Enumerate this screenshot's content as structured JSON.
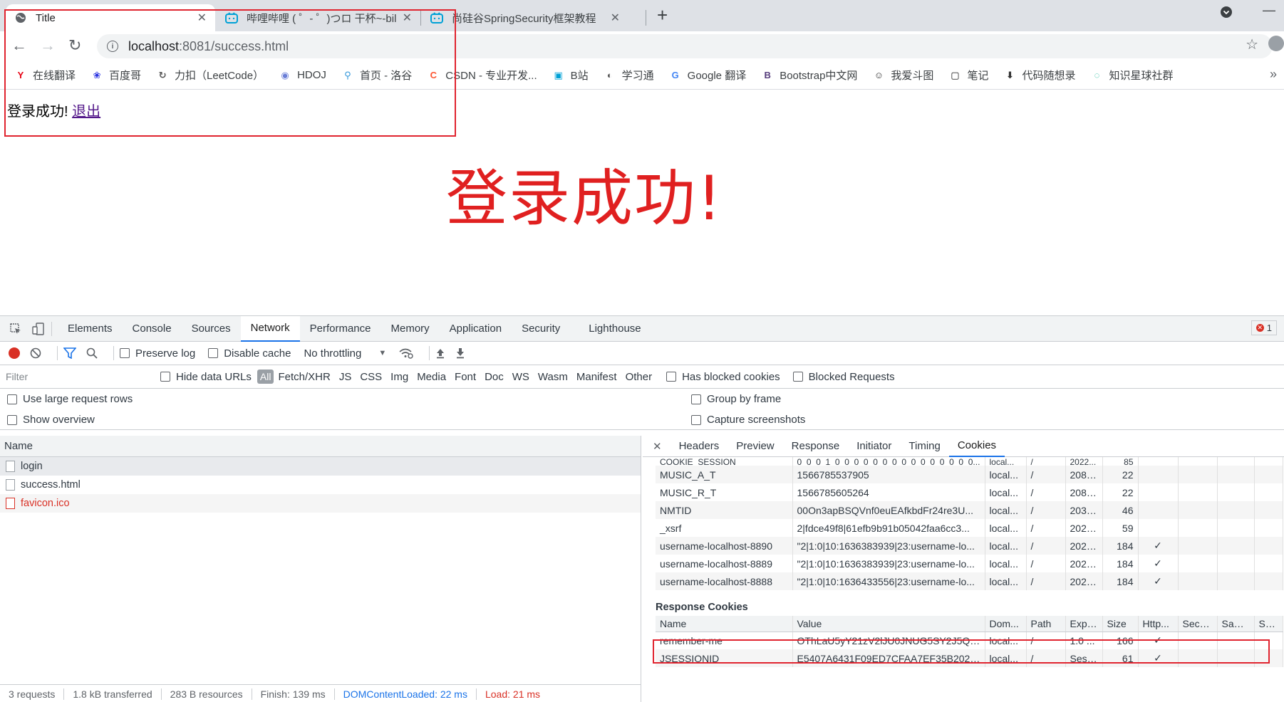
{
  "browser": {
    "tabs": [
      {
        "title": "Title"
      },
      {
        "title": "哔哩哔哩 ( ゜- ゜)つロ 干杯~-bilibili"
      },
      {
        "title": "尚硅谷SpringSecurity框架教程"
      }
    ],
    "url_host": "localhost",
    "url_rest": ":8081/success.html",
    "bookmarks": [
      {
        "label": "在线翻译",
        "icon": "Y",
        "color": "#e60012"
      },
      {
        "label": "百度哥",
        "icon": "❀",
        "color": "#2932e1"
      },
      {
        "label": "力扣（LeetCode）",
        "icon": "↻",
        "color": "#555"
      },
      {
        "label": "HDOJ",
        "icon": "◉",
        "color": "#6b7fd7"
      },
      {
        "label": "首页 - 洛谷",
        "icon": "⚲",
        "color": "#3498db"
      },
      {
        "label": "CSDN - 专业开发...",
        "icon": "C",
        "color": "#fc5531"
      },
      {
        "label": "B站",
        "icon": "▣",
        "color": "#00a1d6"
      },
      {
        "label": "学习通",
        "icon": "◐",
        "color": "#555"
      },
      {
        "label": "Google 翻译",
        "icon": "G",
        "color": "#4285f4"
      },
      {
        "label": "Bootstrap中文网",
        "icon": "B",
        "color": "#563d7c"
      },
      {
        "label": "我爱斗图",
        "icon": "☺",
        "color": "#333"
      },
      {
        "label": "笔记",
        "icon": "▢",
        "color": "#111"
      },
      {
        "label": "代码随想录",
        "icon": "⬇",
        "color": "#333"
      },
      {
        "label": "知识星球社群",
        "icon": "◌",
        "color": "#16b998"
      }
    ]
  },
  "page": {
    "message": "登录成功! ",
    "logout_link": "退出",
    "big_title": "登录成功!"
  },
  "devtools": {
    "tabs": [
      "Elements",
      "Console",
      "Sources",
      "Network",
      "Performance",
      "Memory",
      "Application",
      "Security",
      "Lighthouse"
    ],
    "active_tab": "Network",
    "error_count": "1",
    "toolbar": {
      "preserve_log": "Preserve log",
      "disable_cache": "Disable cache",
      "throttling": "No throttling"
    },
    "filter": {
      "placeholder": "Filter",
      "hide_data_urls": "Hide data URLs",
      "types": [
        "All",
        "Fetch/XHR",
        "JS",
        "CSS",
        "Img",
        "Media",
        "Font",
        "Doc",
        "WS",
        "Wasm",
        "Manifest",
        "Other"
      ],
      "has_blocked_cookies": "Has blocked cookies",
      "blocked_requests": "Blocked Requests"
    },
    "options": {
      "large_rows": "Use large request rows",
      "show_overview": "Show overview",
      "group_by_frame": "Group by frame",
      "capture_screenshots": "Capture screenshots"
    },
    "requests": {
      "header": "Name",
      "items": [
        "login",
        "success.html",
        "favicon.ico"
      ]
    },
    "status": {
      "requests": "3 requests",
      "transferred": "1.8 kB transferred",
      "resources": "283 B resources",
      "finish": "Finish: 139 ms",
      "dcl": "DOMContentLoaded: 22 ms",
      "load": "Load: 21 ms"
    },
    "detail_tabs": [
      "Headers",
      "Preview",
      "Response",
      "Initiator",
      "Timing",
      "Cookies"
    ],
    "active_detail_tab": "Cookies",
    "request_cookies": [
      {
        "name": "COOKIE_SESSION",
        "value": "0_0_0_1_0_0_0_0_0_0_0_0_0_0_0_0_0_0_0...",
        "domain": "local...",
        "path": "/",
        "expires": "2022...",
        "size": "85",
        "http": ""
      },
      {
        "name": "MUSIC_A_T",
        "value": "1566785537905",
        "domain": "local...",
        "path": "/",
        "expires": "2089...",
        "size": "22",
        "http": ""
      },
      {
        "name": "MUSIC_R_T",
        "value": "1566785605264",
        "domain": "local...",
        "path": "/",
        "expires": "2089...",
        "size": "22",
        "http": ""
      },
      {
        "name": "NMTID",
        "value": "00On3apBSQVnf0euEAfkbdFr24re3U...",
        "domain": "local...",
        "path": "/",
        "expires": "2031...",
        "size": "46",
        "http": ""
      },
      {
        "name": "_xsrf",
        "value": "2|fdce49f8|61efb9b91b05042faa6cc3...",
        "domain": "local...",
        "path": "/",
        "expires": "2021...",
        "size": "59",
        "http": ""
      },
      {
        "name": "username-localhost-8890",
        "value": "\"2|1:0|10:1636383939|23:username-lo...",
        "domain": "local...",
        "path": "/",
        "expires": "2021...",
        "size": "184",
        "http": "✓"
      },
      {
        "name": "username-localhost-8889",
        "value": "\"2|1:0|10:1636383939|23:username-lo...",
        "domain": "local...",
        "path": "/",
        "expires": "2021...",
        "size": "184",
        "http": "✓"
      },
      {
        "name": "username-localhost-8888",
        "value": "\"2|1:0|10:1636433556|23:username-lo...",
        "domain": "local...",
        "path": "/",
        "expires": "2021...",
        "size": "184",
        "http": "✓"
      }
    ],
    "response_cookies_title": "Response Cookies",
    "response_columns": [
      "Name",
      "Value",
      "Dom...",
      "Path",
      "Expir...",
      "Size",
      "Http...",
      "Secure",
      "Sam...",
      "Sam"
    ],
    "response_cookies": [
      {
        "name": "remember-me",
        "value": "OThLaU5yY21zV2lJU0JNUG5SY2J5QS...",
        "domain": "local...",
        "path": "/",
        "expires": "1.0 ...",
        "size": "166",
        "http": "✓"
      },
      {
        "name": "JSESSIONID",
        "value": "E5407A6431F09ED7CFAA7EF35B2021...",
        "domain": "local...",
        "path": "/",
        "expires": "Sessi...",
        "size": "61",
        "http": "✓"
      }
    ]
  }
}
